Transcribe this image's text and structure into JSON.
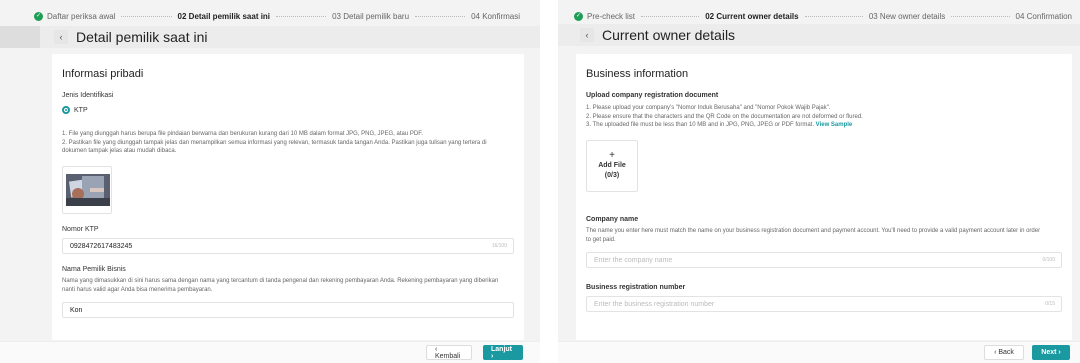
{
  "left": {
    "steps": [
      {
        "label": "Daftar periksa awal",
        "state": "done"
      },
      {
        "label": "02 Detail pemilik saat ini",
        "state": "active"
      },
      {
        "label": "03 Detail pemilik baru",
        "state": "todo"
      },
      {
        "label": "04 Konfirmasi",
        "state": "todo"
      }
    ],
    "back_chevron": "‹",
    "title": "Detail pemilik saat ini",
    "section_title": "Informasi pribadi",
    "id_type_label": "Jenis Identifikasi",
    "id_option": "KTP",
    "help_lines": [
      "1. File yang diunggah harus berupa file pindaian berwarna dan berukuran kurang dari 10 MB dalam format JPG, PNG, JPEG, atau PDF.",
      "2. Pastikan file yang diunggah tampak jelas dan menampilkan semua informasi yang relevan, termasuk tanda tangan Anda. Pastikan juga tulisan yang tertera di dokumen tampak jelas atau mudah dibaca."
    ],
    "ktp_label": "Nomor KTP",
    "ktp_value": "0928472617483245",
    "ktp_counter": "16/100",
    "owner_label": "Nama Pemilik Bisnis",
    "owner_help": "Nama yang dimasukkan di sini harus sama dengan nama yang tercantum di tanda pengenal dan rekening pembayaran Anda. Rekening pembayaran yang diberikan nanti harus valid agar Anda bisa menerima pembayaran.",
    "owner_value": "Kon",
    "back_btn": "‹ Kembali",
    "next_btn": "Lanjut ›"
  },
  "right": {
    "steps": [
      {
        "label": "Pre-check list",
        "state": "done"
      },
      {
        "label": "02 Current owner details",
        "state": "active"
      },
      {
        "label": "03 New owner details",
        "state": "todo"
      },
      {
        "label": "04 Confirmation",
        "state": "todo"
      }
    ],
    "back_chevron": "‹",
    "title": "Current owner details",
    "section_title": "Business information",
    "upload_label": "Upload company registration document",
    "help_lines": [
      "1. Please upload your company's \"Nomor Induk Berusaha\" and \"Nomor Pokok Wajib Pajak\".",
      "2. Please ensure that the characters and the QR Code on the documentation are not deformed or flured."
    ],
    "help_line3": "3. The uploaded file must be less than 10 MB and in JPG, PNG, JPEG or PDF format.",
    "view_sample": "View Sample",
    "add_plus": "+",
    "add_file": "Add File",
    "add_count": "(0/3)",
    "company_label": "Company name",
    "company_help": "The name you enter here must match the name on your business registration document and payment account. You'll need to provide a valid payment account later in order to get paid.",
    "company_placeholder": "Enter the company name",
    "company_counter": "0/100",
    "regno_label": "Business registration number",
    "regno_placeholder": "Enter the business registration number",
    "regno_counter": "0/15",
    "back_btn": "‹ Back",
    "next_btn": "Next ›"
  },
  "colors": {
    "accent": "#1a9aa0",
    "success": "#1f9d55"
  }
}
